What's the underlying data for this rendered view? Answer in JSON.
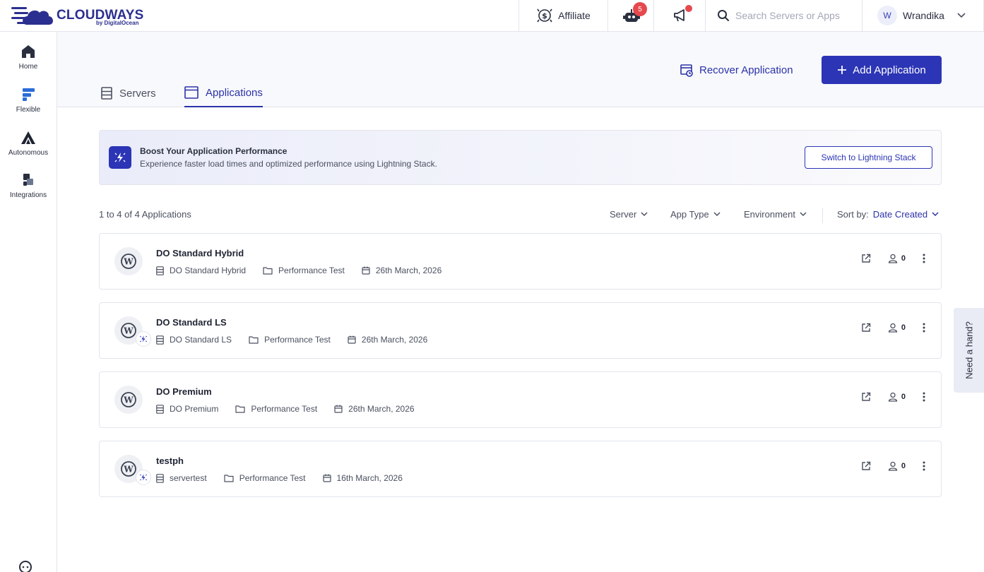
{
  "brand": {
    "name": "CLOUDWAYS",
    "sub": "by DigitalOcean"
  },
  "topbar": {
    "affiliate_label": "Affiliate",
    "bot_badge": "5",
    "search_placeholder": "Search Servers or Apps",
    "user_initial": "W",
    "username": "Wrandika"
  },
  "sidebar": {
    "items": [
      {
        "label": "Home"
      },
      {
        "label": "Flexible"
      },
      {
        "label": "Autonomous"
      },
      {
        "label": "Integrations"
      }
    ]
  },
  "header": {
    "tabs": [
      {
        "label": "Servers",
        "active": false
      },
      {
        "label": "Applications",
        "active": true
      }
    ],
    "recover_label": "Recover Application",
    "add_label": "Add Application"
  },
  "banner": {
    "title": "Boost Your Application Performance",
    "text": "Experience faster load times and optimized performance using Lightning Stack.",
    "button": "Switch to Lightning Stack"
  },
  "list": {
    "count_text": "1 to 4 of 4 Applications",
    "filters": {
      "server": "Server",
      "app_type": "App Type",
      "environment": "Environment",
      "sort_prefix": "Sort by:",
      "sort_value": "Date Created"
    }
  },
  "apps": [
    {
      "name": "DO Standard Hybrid",
      "server": "DO Standard Hybrid",
      "project": "Performance Test",
      "date": "26th March, 2026",
      "users": "0",
      "lightning": false
    },
    {
      "name": "DO Standard LS",
      "server": "DO Standard LS",
      "project": "Performance Test",
      "date": "26th March, 2026",
      "users": "0",
      "lightning": true
    },
    {
      "name": "DO Premium",
      "server": "DO Premium",
      "project": "Performance Test",
      "date": "26th March, 2026",
      "users": "0",
      "lightning": false
    },
    {
      "name": "testph",
      "server": "servertest",
      "project": "Performance Test",
      "date": "16th March, 2026",
      "users": "0",
      "lightning": true
    }
  ],
  "help_tab": "Need a hand?"
}
